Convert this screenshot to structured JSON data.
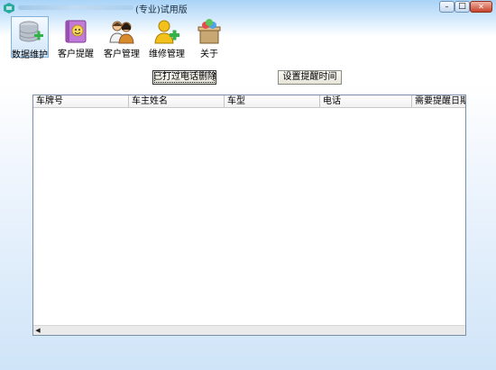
{
  "window": {
    "title": "(专业)试用版",
    "controls": {
      "minimize": "minimize",
      "maximize": "maximize",
      "close": "close"
    }
  },
  "toolbar": {
    "items": [
      {
        "label": "数据维护",
        "icon": "database-icon",
        "active": true
      },
      {
        "label": "客户提醒",
        "icon": "reminder-book-icon"
      },
      {
        "label": "客户管理",
        "icon": "users-icon"
      },
      {
        "label": "维修管理",
        "icon": "add-user-icon"
      },
      {
        "label": "关于",
        "icon": "about-icon"
      }
    ]
  },
  "actions": {
    "called_label": "已打过电话删除",
    "set_reminder_label": "设置提醒时间"
  },
  "table": {
    "columns": [
      "车牌号",
      "车主姓名",
      "车型",
      "电话",
      "需要提醒日期"
    ],
    "rows": []
  },
  "colors": {
    "accent": "#7fb2dd",
    "background_top": "#a9d3f7",
    "icon_green": "#33b24a"
  }
}
